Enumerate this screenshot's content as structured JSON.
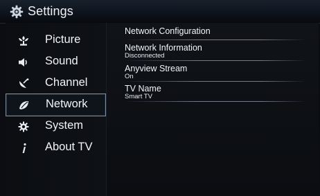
{
  "header": {
    "title": "Settings",
    "icon": "gear-icon"
  },
  "menu": {
    "items": [
      {
        "label": "Picture",
        "icon": "picture-icon"
      },
      {
        "label": "Sound",
        "icon": "speaker-icon"
      },
      {
        "label": "Channel",
        "icon": "satellite-dish-icon"
      },
      {
        "label": "Network",
        "icon": "network-icon",
        "selected": true
      },
      {
        "label": "System",
        "icon": "system-gear-icon"
      },
      {
        "label": "About TV",
        "icon": "info-icon"
      }
    ]
  },
  "network": {
    "items": [
      {
        "name": "Network Configuration",
        "value": ""
      },
      {
        "name": "Network Information",
        "value": "Disconnected"
      },
      {
        "name": "Anyview Stream",
        "value": "On"
      },
      {
        "name": "TV Name",
        "value": "Smart TV"
      }
    ]
  },
  "colors": {
    "background": "#0b0d12",
    "titlebar": "#101720",
    "selection_border": "#7d8ea3",
    "text": "#f2f4f7"
  }
}
